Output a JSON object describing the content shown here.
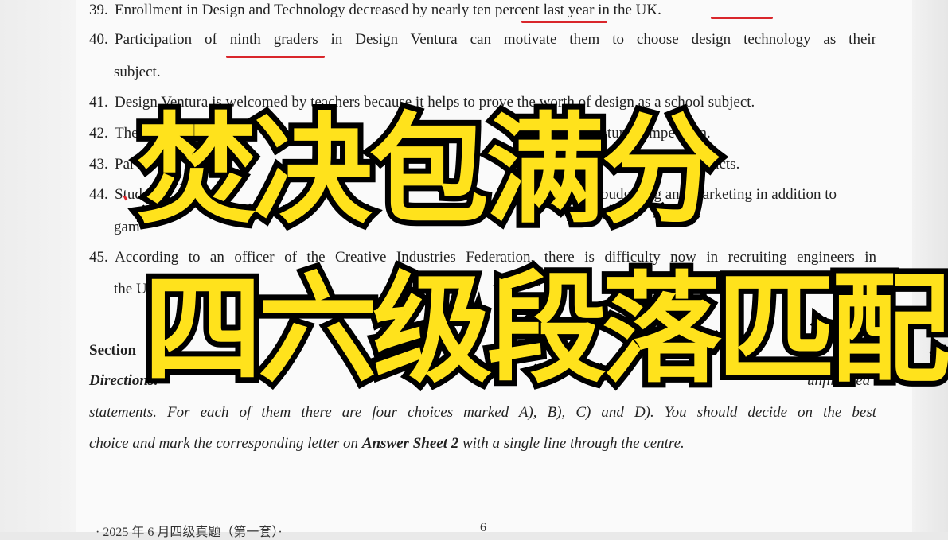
{
  "questions": [
    {
      "number": "39.",
      "text": "Enrollment in Design and Technology decreased by nearly ten percent last year in the UK."
    },
    {
      "number": "40.",
      "text": "Participation of ninth graders in Design Ventura can motivate them to choose design technology as their",
      "continuation": "subject."
    },
    {
      "number": "41.",
      "text": "Design Ventura is welcomed by teachers because it helps to prove the worth of design as a school subject."
    },
    {
      "number": "42.",
      "text": "The",
      "tail": "entura competition."
    },
    {
      "number": "43.",
      "text": "Par",
      "tail": "marketable products."
    },
    {
      "number": "44.",
      "text": "Stud",
      "tail": "budgeting and marketing in addition to",
      "continuation": "gam"
    },
    {
      "number": "45.",
      "text": "According to an officer of the Creative Industries Federation, there is difficulty now in recruiting engineers in",
      "continuation": "the UK."
    }
  ],
  "section": {
    "title": "Section"
  },
  "directions": {
    "label": "Directions:",
    "line1_tail": "unfinished",
    "line2": "statements. For each of them there are four choices marked A), B), C) and D). You should decide on the best",
    "line3_start": "choice and mark the corresponding letter on",
    "line3_bold": "Answer Sheet 2",
    "line3_end": "with a single line through the centre."
  },
  "footer": {
    "left": "· 2025 年 6 月四级真题（第一套）·",
    "page": "6"
  },
  "overlay": {
    "line1": "焚决包满分",
    "line2": "四六级段落匹配",
    "fill_color": "#ffe21c",
    "stroke_color": "#000000"
  },
  "annotation_color": "#d9262b"
}
